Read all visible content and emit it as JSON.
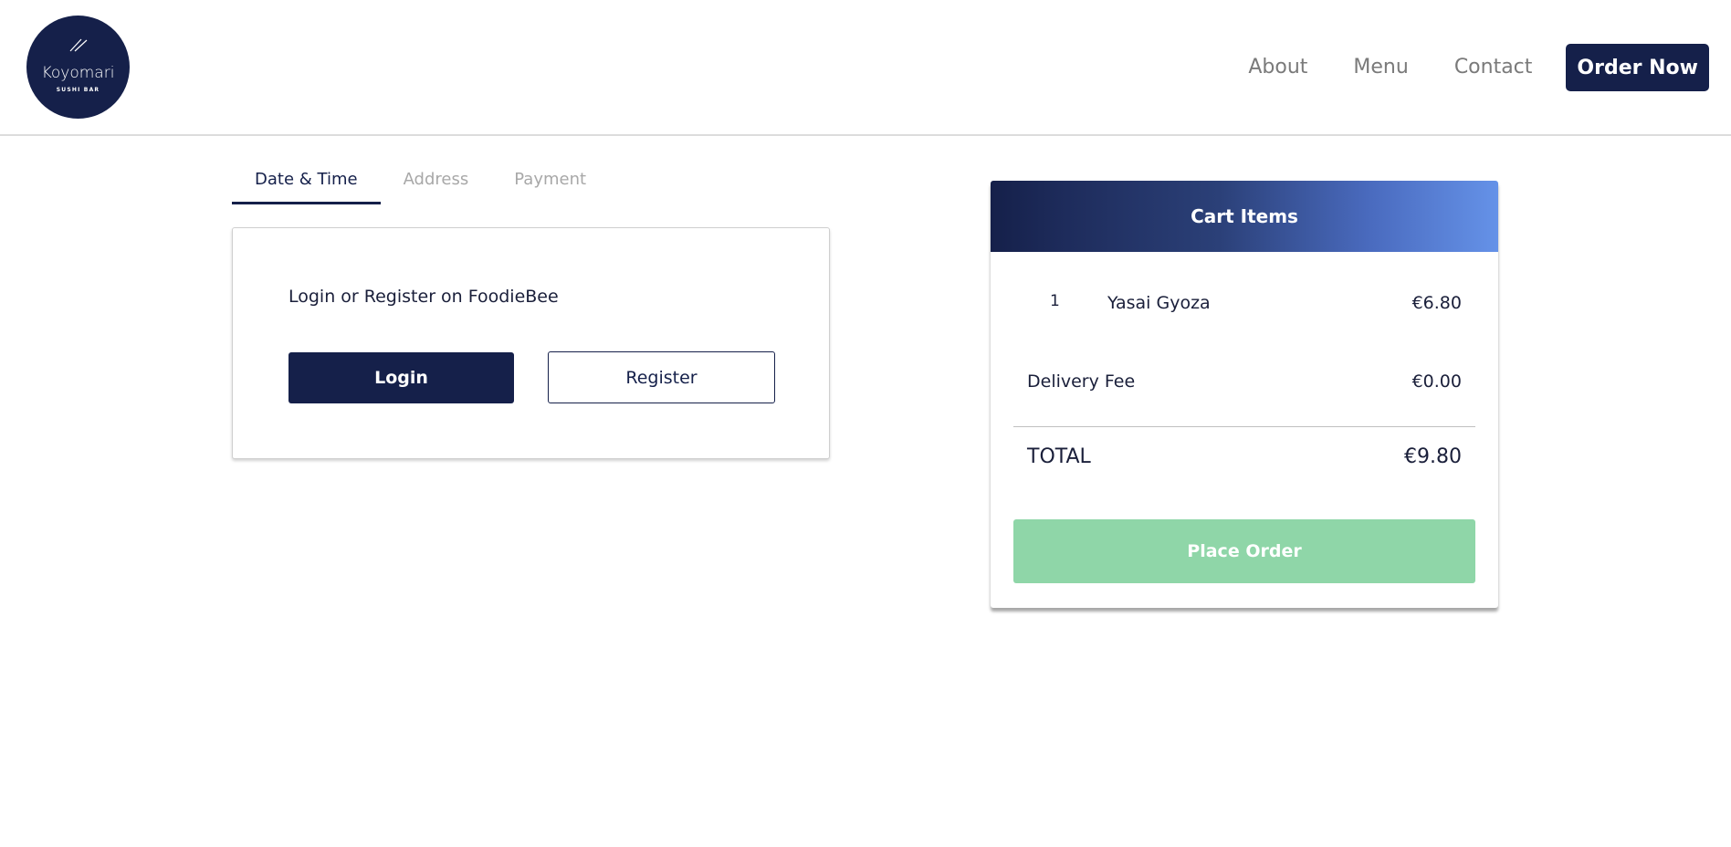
{
  "header": {
    "logo": {
      "brand": "Koyomari",
      "subtitle": "SUSHI BAR"
    },
    "nav": [
      {
        "label": "About"
      },
      {
        "label": "Menu"
      },
      {
        "label": "Contact"
      }
    ],
    "order_now_label": "Order Now"
  },
  "checkout": {
    "tabs": [
      {
        "label": "Date & Time",
        "active": true
      },
      {
        "label": "Address",
        "active": false
      },
      {
        "label": "Payment",
        "active": false
      }
    ],
    "login_card": {
      "title": "Login or Register on FoodieBee",
      "login_label": "Login",
      "register_label": "Register"
    }
  },
  "cart": {
    "title": "Cart Items",
    "items": [
      {
        "qty": "1",
        "name": "Yasai Gyoza",
        "price": "€6.80"
      }
    ],
    "delivery_fee_label": "Delivery Fee",
    "delivery_fee_value": "€0.00",
    "total_label": "TOTAL",
    "total_value": "€9.80",
    "place_order_label": "Place Order"
  },
  "colors": {
    "brand_navy": "#15204a",
    "place_order_green": "#8fd6a8",
    "gradient_end": "#6592e8"
  }
}
